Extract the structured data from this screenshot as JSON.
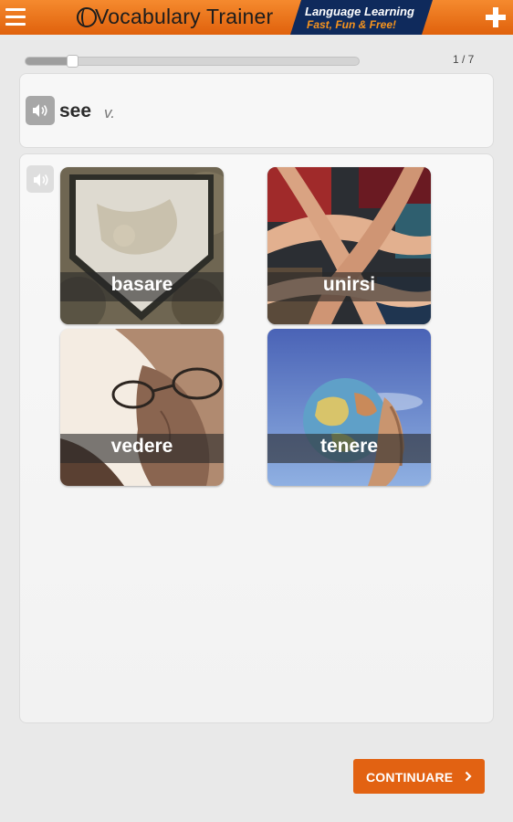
{
  "header": {
    "title": "Vocabulary Trainer",
    "tagline_line1": "Language Learning",
    "tagline_line2": "Fast, Fun & Free!",
    "menu_icon": "hamburger-menu-icon",
    "add_icon": "plus-icon",
    "logo_icon": "globe-logo-icon"
  },
  "progress": {
    "counter": "1 / 7",
    "value": 0.14
  },
  "question": {
    "word": "see",
    "part_of_speech": "v.",
    "audio_icon": "speaker-icon"
  },
  "answers": [
    {
      "label": "basare"
    },
    {
      "label": "unirsi"
    },
    {
      "label": "vedere"
    },
    {
      "label": "tenere"
    }
  ],
  "footer": {
    "continue_label": "CONTINUARE",
    "continue_icon": "chevron-right-icon"
  },
  "colors": {
    "accent": "#e26212",
    "header_gradient_top": "#f58a2e",
    "tagline_bg": "#0f2a5c",
    "tagline_highlight": "#f7941d"
  }
}
